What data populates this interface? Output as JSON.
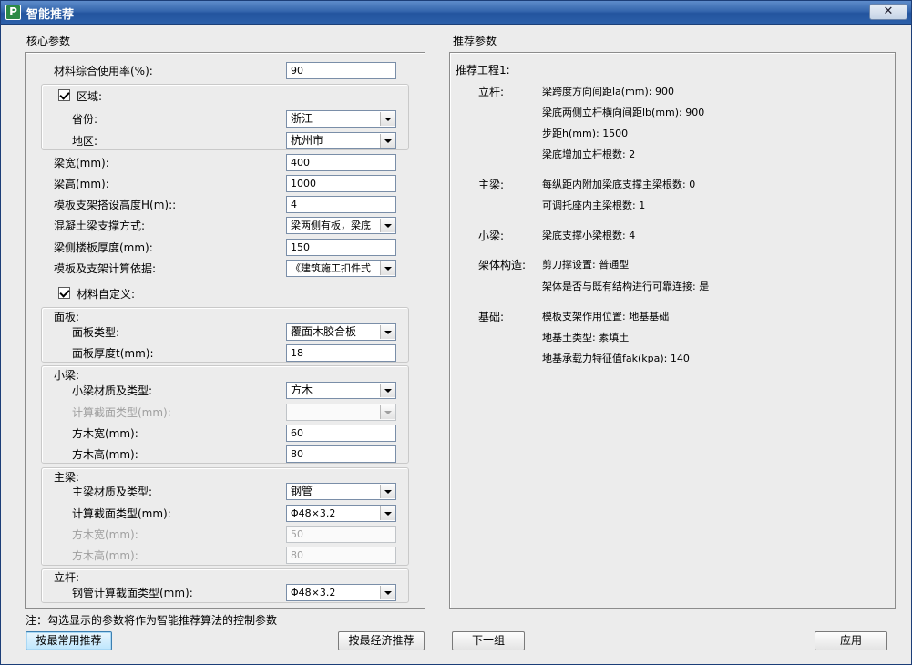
{
  "window": {
    "title": "智能推荐",
    "icon_letter": "P",
    "close_glyph": "✕"
  },
  "left": {
    "title": "核心参数",
    "material_rate": {
      "label": "材料综合使用率(%):",
      "value": "90"
    },
    "region": {
      "checkbox_label": "区域:",
      "checked": true,
      "province_label": "省份:",
      "province_value": "浙江",
      "area_label": "地区:",
      "area_value": "杭州市"
    },
    "beam_width": {
      "label": "梁宽(mm):",
      "value": "400"
    },
    "beam_height": {
      "label": "梁高(mm):",
      "value": "1000"
    },
    "support_height": {
      "label": "模板支架搭设高度H(m)::",
      "value": "4"
    },
    "support_method": {
      "label": "混凝土梁支撑方式:",
      "value": "梁两侧有板，梁底"
    },
    "slab_thickness": {
      "label": "梁侧楼板厚度(mm):",
      "value": "150"
    },
    "calc_basis": {
      "label": "模板及支架计算依据:",
      "value": "《建筑施工扣件式"
    },
    "custom_material": {
      "label": "材料自定义:",
      "checked": true
    },
    "panel": {
      "title": "面板:",
      "type_label": "面板类型:",
      "type_value": "覆面木胶合板",
      "thickness_label": "面板厚度t(mm):",
      "thickness_value": "18"
    },
    "small_beam": {
      "title": "小梁:",
      "material_label": "小梁材质及类型:",
      "material_value": "方木",
      "section_label": "计算截面类型(mm):",
      "section_value": "",
      "width_label": "方木宽(mm):",
      "width_value": "60",
      "height_label": "方木高(mm):",
      "height_value": "80"
    },
    "main_beam": {
      "title": "主梁:",
      "material_label": "主梁材质及类型:",
      "material_value": "钢管",
      "section_label": "计算截面类型(mm):",
      "section_value": "Φ48×3.2",
      "width_label": "方木宽(mm):",
      "width_value": "50",
      "height_label": "方木高(mm):",
      "height_value": "80"
    },
    "pole": {
      "title": "立杆:",
      "section_label": "钢管计算截面类型(mm):",
      "section_value": "Φ48×3.2"
    }
  },
  "note": "注：勾选显示的参数将作为智能推荐算法的控制参数",
  "right": {
    "title": "推荐参数",
    "project": "推荐工程1:",
    "pole_label": "立杆:",
    "pole_items": [
      "梁跨度方向间距la(mm): 900",
      "梁底两侧立杆横向间距lb(mm): 900",
      "步距h(mm): 1500",
      "梁底增加立杆根数: 2"
    ],
    "main_beam_label": "主梁:",
    "main_beam_items": [
      "每纵距内附加梁底支撑主梁根数: 0",
      "可调托座内主梁根数: 1"
    ],
    "small_beam_label": "小梁:",
    "small_beam_items": [
      "梁底支撑小梁根数: 4"
    ],
    "frame_label": "架体构造:",
    "frame_items": [
      "剪刀撑设置: 普通型",
      "架体是否与既有结构进行可靠连接: 是"
    ],
    "foundation_label": "基础:",
    "foundation_items": [
      "模板支架作用位置: 地基基础",
      "地基土类型: 素填土",
      "地基承载力特征值fak(kpa): 140"
    ]
  },
  "buttons": {
    "common": "按最常用推荐",
    "economic": "按最经济推荐",
    "next": "下一组",
    "apply": "应用"
  }
}
